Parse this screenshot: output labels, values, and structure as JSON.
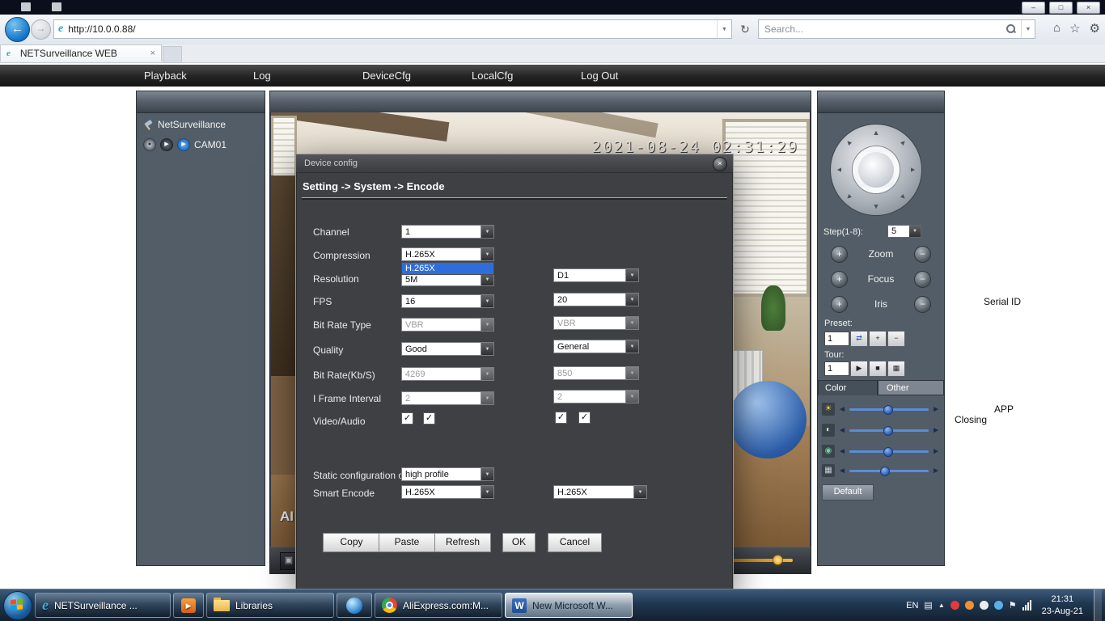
{
  "glyphs": {
    "dropdown": "▼",
    "tri": "▲",
    "left_arrow": "◄",
    "right_arrow": "►",
    "back": "←",
    "forward": "→",
    "refresh": "↻",
    "home": "⌂",
    "star": "☆",
    "gear": "⚙",
    "close": "×",
    "minimize": "–",
    "maximize": "□",
    "check": "✓",
    "play": "▶",
    "stop": "■",
    "grid": "▦",
    "plus": "+",
    "minus": "−",
    "sun": "☀",
    "contrast": "◐",
    "saturation": "◉",
    "goto": "⇄",
    "flag": "⚑",
    "keyboard": "▤",
    "screen_btn": "▣",
    "rec": "●"
  },
  "browser": {
    "url": "http://10.0.0.88/",
    "search_placeholder": "Search...",
    "tab_title": "NETSurveillance WEB"
  },
  "menu": {
    "items": [
      "Playback",
      "Log",
      "DeviceCfg",
      "LocalCfg",
      "Log Out"
    ]
  },
  "tree": {
    "root": "NetSurveillance",
    "camera": "CAM01"
  },
  "video": {
    "timestamp": "2021-08-24 02:31:29",
    "overlay_label": "AI"
  },
  "dialog": {
    "title": "Device config",
    "header": "Setting -> System -> Encode",
    "fields": {
      "channel": {
        "label": "Channel",
        "value": "1"
      },
      "compression": {
        "label": "Compression",
        "value": "H.265X",
        "open_option": "H.265X"
      },
      "resolution": {
        "label": "Resolution",
        "value": "5M",
        "value2": "D1"
      },
      "fps": {
        "label": "FPS",
        "value": "16",
        "value2": "20"
      },
      "bitrate_type": {
        "label": "Bit Rate Type",
        "value": "VBR",
        "value2": "VBR"
      },
      "quality": {
        "label": "Quality",
        "value": "Good",
        "value2": "General"
      },
      "bitrate": {
        "label": "Bit Rate(Kb/S)",
        "value": "4269",
        "value2": "850"
      },
      "iframe": {
        "label": "I Frame Interval",
        "value": "2",
        "value2": "2"
      },
      "video_audio": {
        "label": "Video/Audio"
      },
      "static_config": {
        "label": "Static configuration of",
        "value": "high profile"
      },
      "smart_encode": {
        "label": "Smart Encode",
        "value": "H.265X",
        "value2": "H.265X"
      }
    },
    "buttons": {
      "copy": "Copy",
      "paste": "Paste",
      "refresh": "Refresh",
      "ok": "OK",
      "cancel": "Cancel"
    }
  },
  "ptz": {
    "step_label": "Step(1-8):",
    "step_value": "5",
    "zoom": "Zoom",
    "focus": "Focus",
    "iris": "Iris",
    "preset_label": "Preset:",
    "preset_value": "1",
    "tour_label": "Tour:",
    "tour_value": "1",
    "tab_color": "Color",
    "tab_other": "Other",
    "default_button": "Default"
  },
  "page_texts": {
    "serial_id": "Serial ID",
    "app": "APP",
    "closing": "Closing"
  },
  "taskbar": {
    "apps": {
      "ie": "NETSurveillance ...",
      "libraries": "Libraries",
      "chrome": "AliExpress.com:M...",
      "word": "New Microsoft W..."
    },
    "tray_lang": "EN",
    "clock_time": "21:31",
    "clock_date": "23-Aug-21"
  }
}
